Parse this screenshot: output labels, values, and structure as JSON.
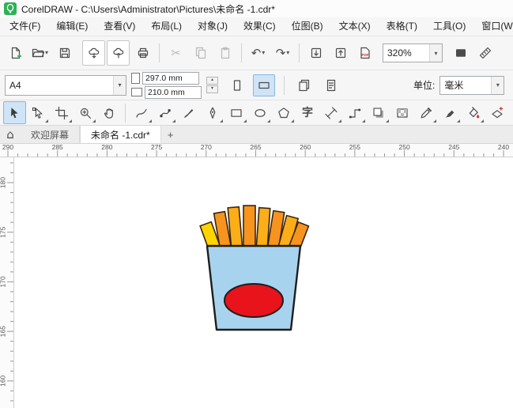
{
  "window": {
    "title": "CorelDRAW - C:\\Users\\Administrator\\Pictures\\未命名 -1.cdr*",
    "app_icon": "coreldraw-logo-icon"
  },
  "menu": {
    "items": [
      {
        "name": "file",
        "label": "文件(F)"
      },
      {
        "name": "edit",
        "label": "编辑(E)"
      },
      {
        "name": "view",
        "label": "查看(V)"
      },
      {
        "name": "layout",
        "label": "布局(L)"
      },
      {
        "name": "object",
        "label": "对象(J)"
      },
      {
        "name": "effects",
        "label": "效果(C)"
      },
      {
        "name": "bitmaps",
        "label": "位图(B)"
      },
      {
        "name": "text",
        "label": "文本(X)"
      },
      {
        "name": "table",
        "label": "表格(T)"
      },
      {
        "name": "tools",
        "label": "工具(O)"
      },
      {
        "name": "window",
        "label": "窗口(W)"
      }
    ]
  },
  "standard_toolbar": {
    "zoom_level": "320%",
    "items": [
      {
        "type": "button",
        "name": "new-document-button",
        "icon": "new-doc-icon"
      },
      {
        "type": "button",
        "name": "open-button",
        "icon": "open-folder-icon",
        "caret": true
      },
      {
        "type": "button",
        "name": "save-button",
        "icon": "save-icon"
      },
      {
        "type": "gap"
      },
      {
        "type": "button",
        "name": "open-from-cloud-button",
        "icon": "cloud-download-icon",
        "framed": true
      },
      {
        "type": "button",
        "name": "save-to-cloud-button",
        "icon": "cloud-upload-icon",
        "framed": true
      },
      {
        "type": "button",
        "name": "print-button",
        "icon": "printer-icon"
      },
      {
        "type": "separator"
      },
      {
        "type": "button",
        "name": "cut-button",
        "icon": "cut-icon",
        "disabled": true
      },
      {
        "type": "button",
        "name": "copy-button",
        "icon": "copy-icon",
        "disabled": true
      },
      {
        "type": "button",
        "name": "paste-button",
        "icon": "paste-icon",
        "disabled": true
      },
      {
        "type": "separator"
      },
      {
        "type": "button",
        "name": "undo-button",
        "icon": "undo-icon",
        "caret": true
      },
      {
        "type": "button",
        "name": "redo-button",
        "icon": "redo-icon",
        "caret": true
      },
      {
        "type": "separator"
      },
      {
        "type": "button",
        "name": "import-button",
        "icon": "import-icon"
      },
      {
        "type": "button",
        "name": "export-button",
        "icon": "export-icon"
      },
      {
        "type": "button",
        "name": "pdf-button",
        "icon": "pdf-icon"
      },
      {
        "type": "zoom-combo",
        "name": "zoom-level-combobox"
      },
      {
        "type": "button",
        "name": "fullscreen-preview-button",
        "icon": "fullscreen-icon"
      },
      {
        "type": "button",
        "name": "show-rulers-button",
        "icon": "rulers-icon"
      }
    ]
  },
  "property_bar": {
    "page_size": "A4",
    "page_width": "297.0 mm",
    "page_height": "210.0 mm",
    "units_label": "单位:",
    "units": "毫米"
  },
  "toolbox": {
    "items": [
      {
        "name": "pick-tool",
        "icon": "pick-icon",
        "selected": true
      },
      {
        "name": "shape-tool",
        "icon": "shape-icon",
        "flyout": true
      },
      {
        "name": "crop-tool",
        "icon": "crop-icon",
        "flyout": true
      },
      {
        "name": "zoom-tool",
        "icon": "zoom-icon",
        "flyout": true
      },
      {
        "name": "pan-tool",
        "icon": "pan-icon"
      },
      {
        "type": "separator"
      },
      {
        "name": "freehand-tool",
        "icon": "freehand-icon",
        "flyout": true
      },
      {
        "name": "bezier-tool",
        "icon": "bezier-icon",
        "flyout": true
      },
      {
        "name": "artistic-media-tool",
        "icon": "brush-icon"
      },
      {
        "name": "pen-tool",
        "icon": "pen-icon",
        "flyout": true
      },
      {
        "name": "rectangle-tool",
        "icon": "rectangle-icon",
        "flyout": true
      },
      {
        "name": "ellipse-tool",
        "icon": "ellipse-icon",
        "flyout": true
      },
      {
        "name": "polygon-tool",
        "icon": "polygon-icon",
        "flyout": true
      },
      {
        "name": "text-tool",
        "icon": "text-icon"
      },
      {
        "name": "dimension-tool",
        "icon": "dimension-icon",
        "flyout": true
      },
      {
        "name": "connector-tool",
        "icon": "connector-icon",
        "flyout": true
      },
      {
        "name": "drop-shadow-tool",
        "icon": "shadow-icon",
        "flyout": true
      },
      {
        "name": "transparency-tool",
        "icon": "transparency-icon"
      },
      {
        "name": "color-eyedropper-tool",
        "icon": "eyedropper-icon",
        "flyout": true
      },
      {
        "name": "outline-pen-tool",
        "icon": "outline-pen-icon",
        "flyout": true
      },
      {
        "name": "interactive-fill-tool",
        "icon": "fill-icon",
        "flyout": true
      },
      {
        "name": "smart-fill-tool",
        "icon": "smart-fill-icon"
      }
    ]
  },
  "tabs": {
    "home_icon": "home-icon",
    "new_tab_label": "+",
    "items": [
      {
        "name": "welcome-screen",
        "label": "欢迎屏幕",
        "active": false
      },
      {
        "name": "untitled-1",
        "label": "未命名 -1.cdr*",
        "active": true
      }
    ]
  },
  "rulers": {
    "horizontal_labels": [
      "290",
      "285",
      "280",
      "275",
      "270",
      "265",
      "260",
      "255",
      "250",
      "245",
      "240"
    ],
    "vertical_labels": [
      "180",
      "175",
      "170",
      "165",
      "160"
    ]
  },
  "canvas": {
    "drawing": {
      "name": "french-fries-clipart",
      "box_color": "#A8D3EE",
      "logo_color": "#E8131B",
      "fry_colors": [
        "#FFD400",
        "#F7941E",
        "#FBAE17"
      ],
      "outline_color": "#3A2512"
    }
  }
}
